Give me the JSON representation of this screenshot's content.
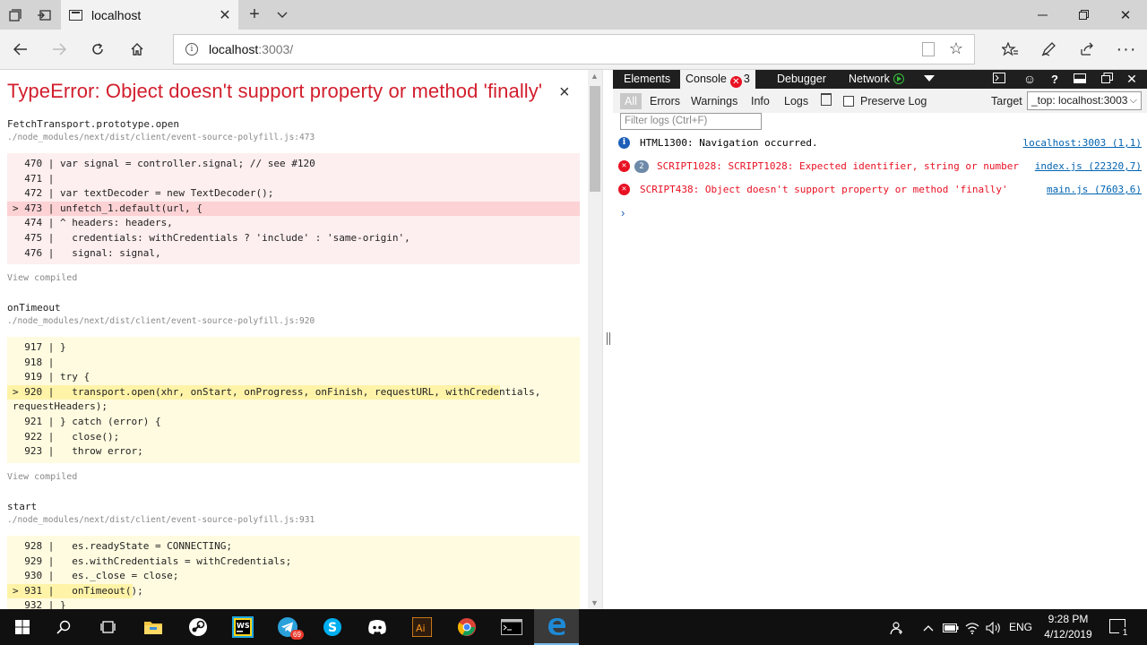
{
  "browser": {
    "tab_title": "localhost",
    "url_host": "localhost",
    "url_rest": ":3003/"
  },
  "error_overlay": {
    "title": "TypeError: Object doesn't support property or method 'finally'",
    "close_glyph": "×",
    "view_compiled": "View compiled",
    "frames": [
      {
        "name": "FetchTransport.prototype.open",
        "path": "./node_modules/next/dist/client/event-source-polyfill.js:473",
        "lines": [
          "  470 | var signal = controller.signal; // see #120",
          "  471 |",
          "  472 | var textDecoder = new TextDecoder();",
          "> 473 | unfetch_1.default(url, {",
          "  474 | ^ headers: headers,",
          "  475 |   credentials: withCredentials ? 'include' : 'same-origin',",
          "  476 |   signal: signal,"
        ]
      },
      {
        "name": "onTimeout",
        "path": "./node_modules/next/dist/client/event-source-polyfill.js:920",
        "lines": [
          "  917 | }",
          "  918 |",
          "  919 | try {",
          "> 920 |   transport.open(xhr, onStart, onProgress, onFinish, requestURL, withCredentials,",
          "requestHeaders);",
          "  921 | } catch (error) {",
          "  922 |   close();",
          "  923 |   throw error;"
        ]
      },
      {
        "name": "start",
        "path": "./node_modules/next/dist/client/event-source-polyfill.js:931",
        "lines": [
          "  928 |   es.readyState = CONNECTING;",
          "  929 |   es.withCredentials = withCredentials;",
          "  930 |   es._close = close;",
          "> 931 |   onTimeout();",
          "  932 | }"
        ]
      }
    ]
  },
  "devtools": {
    "tabs": [
      "Elements",
      "Console",
      "Debugger",
      "Network"
    ],
    "console_error_count": "3",
    "filters": [
      "All",
      "Errors",
      "Warnings",
      "Info",
      "Logs"
    ],
    "preserve_log_label": "Preserve Log",
    "target_label": "Target",
    "target_value": "_top: localhost:3003",
    "filter_placeholder": "Filter logs (Ctrl+F)",
    "messages": [
      {
        "level": "info",
        "text": "HTML1300: Navigation occurred.",
        "source": "localhost:3003 (1,1)",
        "repeat": ""
      },
      {
        "level": "error",
        "text": "SCRIPT1028: SCRIPT1028: Expected identifier, string or number",
        "source": "index.js (22320,7)",
        "repeat": "2"
      },
      {
        "level": "error",
        "text": "SCRIPT438: Object doesn't support property or method 'finally'",
        "source": "main.js (7603,6)",
        "repeat": ""
      }
    ],
    "prompt_glyph": "›"
  },
  "taskbar": {
    "language": "ENG",
    "time": "9:28 PM",
    "date": "4/12/2019",
    "telegram_badge": "69",
    "notification_count": "1"
  },
  "colors": {
    "error_red": "#d21e2d",
    "devtools_dark": "#1f1f1f",
    "link_blue": "#0063b1",
    "taskbar": "#101010"
  }
}
